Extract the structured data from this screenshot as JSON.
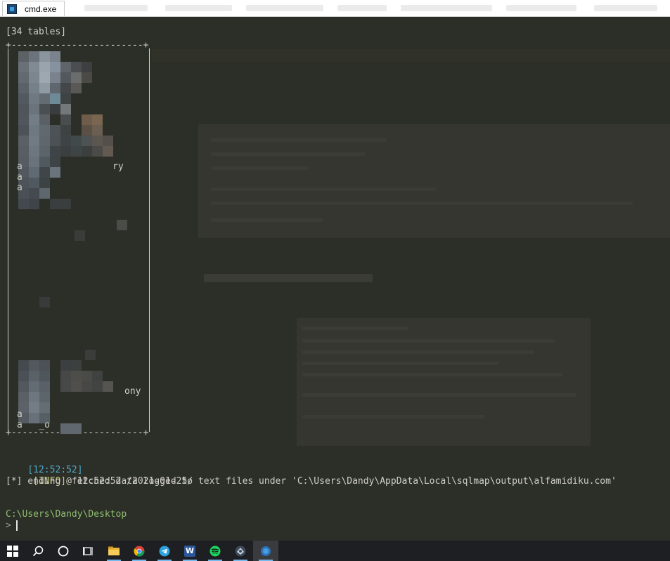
{
  "window": {
    "tab_title": "cmd.exe",
    "tab_icon": "cmd-icon"
  },
  "console": {
    "tables_header": "[34 tables]",
    "table_top_border": "+------------------------+",
    "table_bottom_border": "+------------------------+",
    "fragments": {
      "row1_suffix": "ry",
      "row_letter_a": "a",
      "row2_suffix": "ony",
      "bottom_row": "a   _o"
    },
    "info_line": {
      "time": "[12:52:52]",
      "level": "[INFO]",
      "message": " fetched data logged to text files under 'C:\\Users\\Dandy\\AppData\\Local\\sqlmap\\output\\alfamidiku.com'"
    },
    "ending_line": "[*] ending @ 12:52:52 /2021-01-25/",
    "prompt_path": "C:\\Users\\Dandy\\Desktop",
    "prompt_symbol": ">"
  },
  "taskbar": {
    "items": [
      {
        "name": "start-button",
        "icon": "windows-logo-icon"
      },
      {
        "name": "search-button",
        "icon": "search-icon"
      },
      {
        "name": "cortana-button",
        "icon": "cortana-circle-icon"
      },
      {
        "name": "task-view-button",
        "icon": "task-view-icon"
      },
      {
        "name": "file-explorer-button",
        "icon": "folder-icon"
      },
      {
        "name": "chrome-button",
        "icon": "chrome-icon"
      },
      {
        "name": "telegram-button",
        "icon": "telegram-icon"
      },
      {
        "name": "word-button",
        "icon": "word-icon",
        "label": "W"
      },
      {
        "name": "spotify-button",
        "icon": "spotify-icon"
      },
      {
        "name": "app-button",
        "icon": "app-icon"
      },
      {
        "name": "cmd-taskbar-button",
        "icon": "cmd-icon"
      }
    ]
  },
  "colors": {
    "console_bg": "#2c2e28",
    "time_cyan": "#4fa8c9",
    "info_yellow": "#c8c878",
    "prompt_green": "#8fbf6f",
    "taskbar_bg": "#1e1f22"
  }
}
